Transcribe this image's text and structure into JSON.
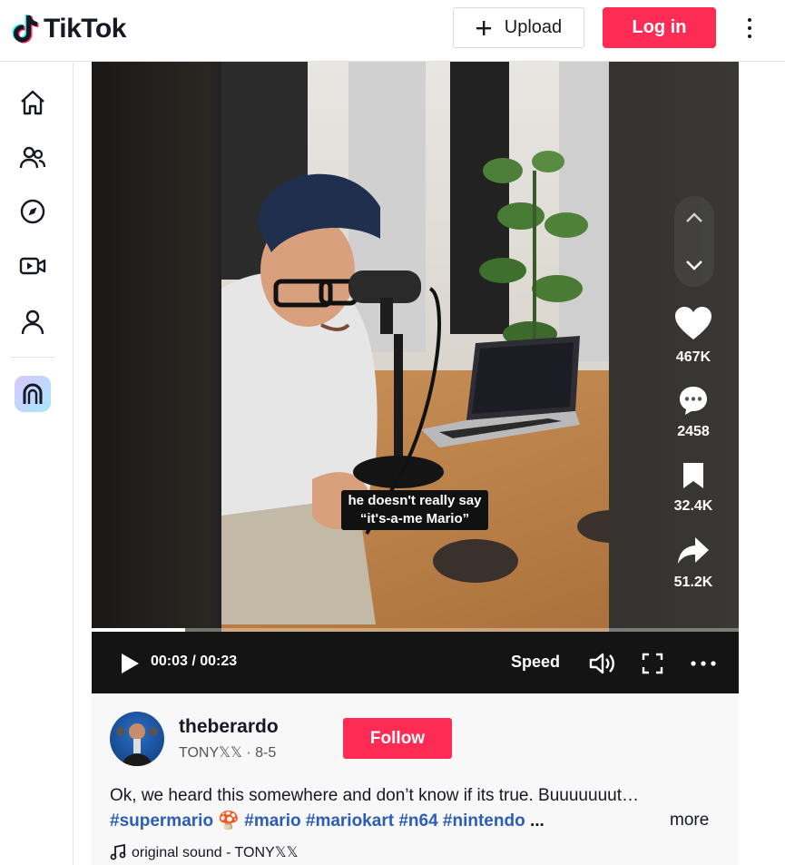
{
  "brand": {
    "name": "TikTok"
  },
  "header": {
    "upload_label": "Upload",
    "login_label": "Log in"
  },
  "sidebar": {
    "items": [
      {
        "icon": "home-icon"
      },
      {
        "icon": "following-icon"
      },
      {
        "icon": "explore-icon"
      },
      {
        "icon": "live-icon"
      },
      {
        "icon": "profile-icon"
      }
    ]
  },
  "video": {
    "caption_line1": "he doesn't really say",
    "caption_line2": "“it's-a-me Mario”",
    "current_time": "00:03",
    "duration": "00:23",
    "time_display": "00:03 / 00:23",
    "progress_fraction": 0.145,
    "speed_label": "Speed"
  },
  "actions": {
    "likes": "467K",
    "comments": "2458",
    "saves": "32.4K",
    "shares": "51.2K"
  },
  "author": {
    "username": "theberardo",
    "subline": "TONY𝕏𝕏 · 8-5",
    "follow_label": "Follow"
  },
  "post": {
    "description": "Ok, we heard this somewhere and don’t know if its true. Buuuuuuut…",
    "tags": [
      "#supermario",
      "#mario",
      "#mariokart",
      "#n64",
      "#nintendo"
    ],
    "tag_separator_glyph": "🍄",
    "ellipsis": "...",
    "more_label": "more",
    "sound": "original sound - TONY𝕏𝕏"
  },
  "colors": {
    "brand_red": "#fe2c55",
    "tag_blue": "#2b5db9"
  }
}
